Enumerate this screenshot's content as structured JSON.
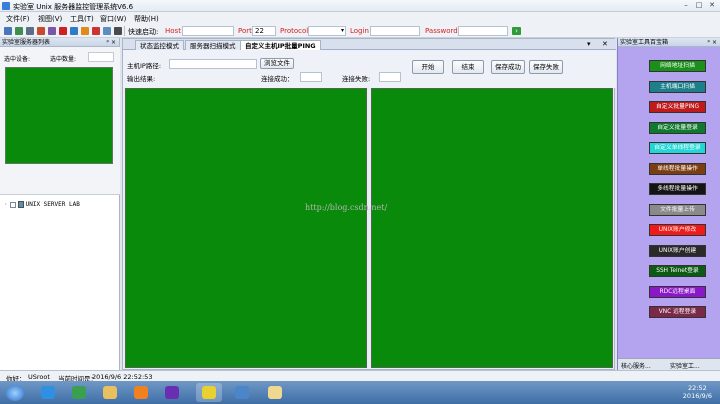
{
  "window": {
    "title": "实验室 Unix 服务器监控管理系统V6.6"
  },
  "menu": [
    "文件(F)",
    "视图(V)",
    "工具(T)",
    "窗口(W)",
    "帮助(H)"
  ],
  "toolbar": {
    "quick_label": "快速启动:",
    "host_label": "Host",
    "port_label": "Port",
    "port_value": "22",
    "protocol_label": "Protocol",
    "login_label": "Login",
    "password_label": "Password",
    "go_label": "›"
  },
  "left_panel": {
    "title": "实验室服务器列表",
    "ctl": "ᵖ ×",
    "selected_device_label": "选中设备:",
    "selected_count_label": "选中数量:",
    "tree_root": "UNIX SERVER LAB"
  },
  "tabs": [
    "状态监控模式",
    "服务器扫描模式",
    "自定义主机IP批量PING"
  ],
  "form": {
    "host_ip_label": "主机IP路径:",
    "browse_label": "浏览文件",
    "output_label": "输出结果:",
    "success_label": "连接成功：",
    "fail_label": "连接失败:",
    "start_btn": "开始",
    "end_btn": "结束",
    "save_success_btn": "保存成功",
    "save_fail_btn": "保存失败"
  },
  "watermark": "http://blog.csdn.net/",
  "right_panel": {
    "title": "实验室工具百宝箱",
    "ctl": "ᵖ ×",
    "buttons": [
      {
        "label": "网络地址扫描",
        "bg": "#1a8f1a",
        "fg": "#ffffff"
      },
      {
        "label": "主机端口扫描",
        "bg": "#1e7f8a",
        "fg": "#ffffff"
      },
      {
        "label": "自定义批量PING",
        "bg": "#c11a1a",
        "fg": "#ffffff"
      },
      {
        "label": "自定义批量登录",
        "bg": "#0f7a2e",
        "fg": "#ffffff"
      },
      {
        "label": "自定义单线程登录",
        "bg": "#22d6d6",
        "fg": "#ffffff"
      },
      {
        "label": "单线程批量操作",
        "bg": "#7a3e12",
        "fg": "#ffffff"
      },
      {
        "label": "多线程批量操作",
        "bg": "#141414",
        "fg": "#ffffff"
      },
      {
        "label": "文件批量上传",
        "bg": "#8a8a8a",
        "fg": "#ffffff"
      },
      {
        "label": "UNIX账户修改",
        "bg": "#ef1a1a",
        "fg": "#ffffff"
      },
      {
        "label": "UNIX账户创建",
        "bg": "#2a2a2a",
        "fg": "#ffffff"
      },
      {
        "label": "SSH Telnet登录",
        "bg": "#0d5a14",
        "fg": "#ffffff"
      },
      {
        "label": "RDC远程桌面",
        "bg": "#8a18c8",
        "fg": "#ffffff"
      },
      {
        "label": "VNC 远程登录",
        "bg": "#7a2a48",
        "fg": "#ffffff"
      }
    ],
    "bottom_tabs": [
      "核心服务...",
      "实验室工..."
    ]
  },
  "status": {
    "greeting": "你好：",
    "user": "USroot",
    "time_label": "当前时间是：",
    "time_value": "2016/9/6 22:52:53"
  },
  "taskbar": {
    "clock_time": "22:52",
    "clock_date": "2016/9/6"
  }
}
